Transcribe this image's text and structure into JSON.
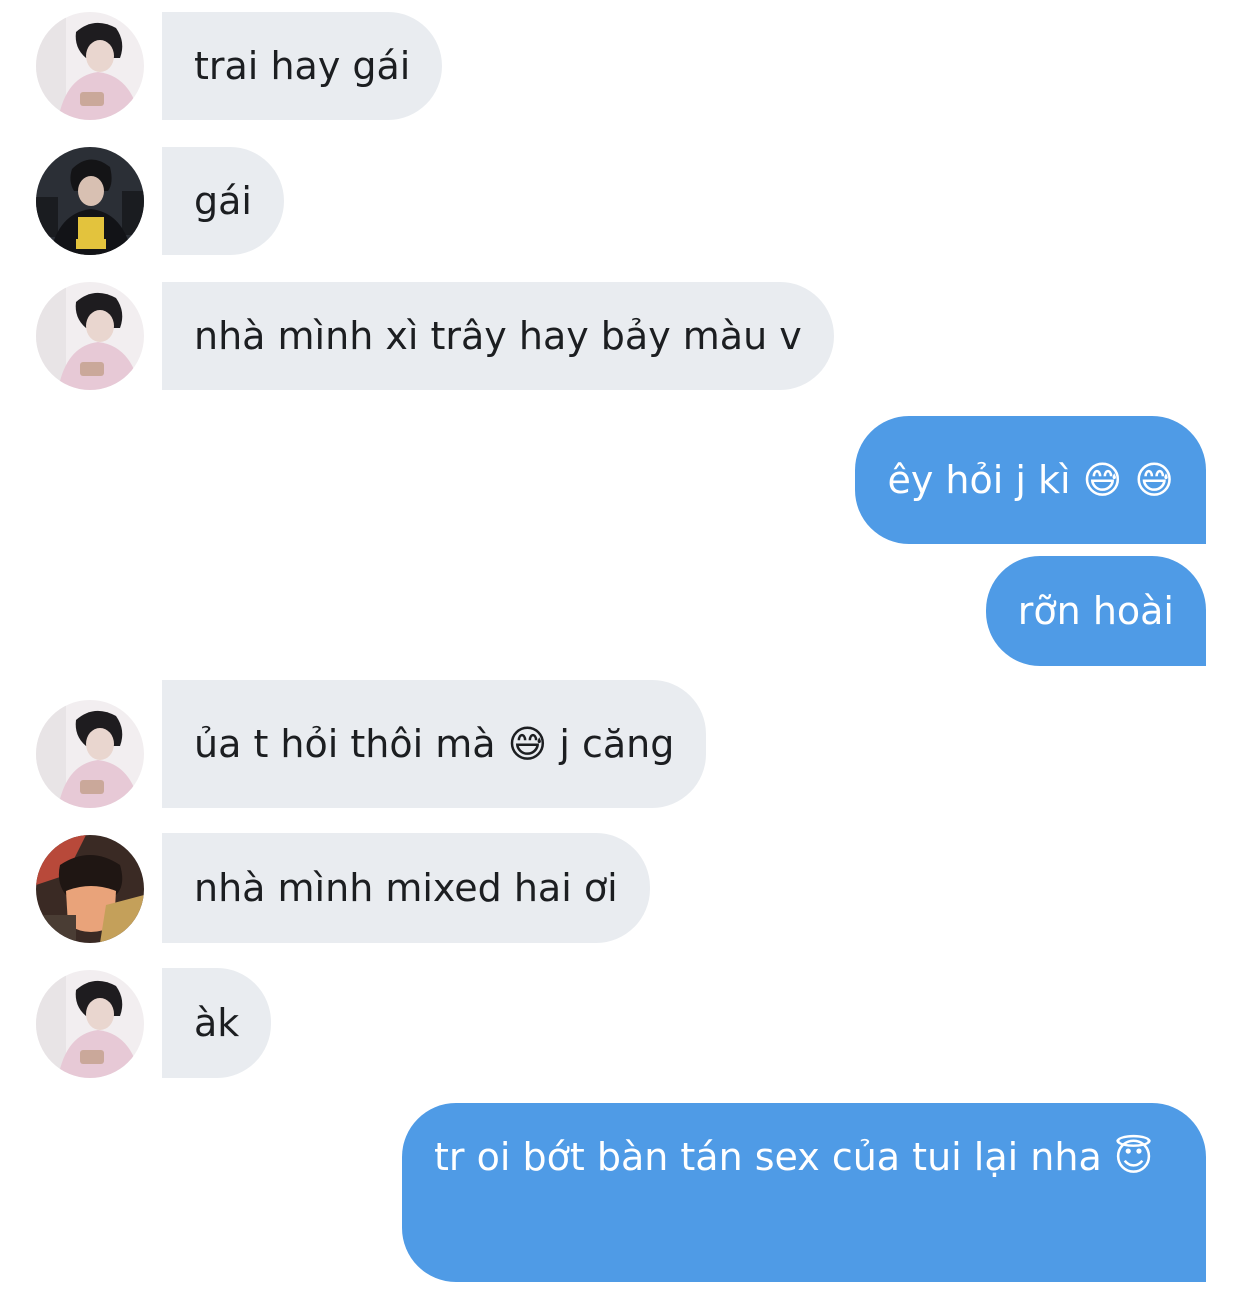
{
  "colors": {
    "incoming_bubble": "#e9ecf0",
    "outgoing_bubble": "#4f9be6",
    "incoming_text": "#1c1e21",
    "outgoing_text": "#ffffff"
  },
  "messages": [
    {
      "direction": "incoming",
      "avatar": "avatar-pink-hoodie",
      "text": "trai hay gái"
    },
    {
      "direction": "incoming",
      "avatar": "avatar-fearx-jersey",
      "text": "gái"
    },
    {
      "direction": "incoming",
      "avatar": "avatar-pink-hoodie",
      "text": "nhà mình xì trây hay bảy màu v"
    },
    {
      "direction": "outgoing",
      "text": "êy hỏi j kì 😅 😅"
    },
    {
      "direction": "outgoing",
      "text": "rỡn hoài"
    },
    {
      "direction": "incoming",
      "avatar": "avatar-pink-hoodie",
      "text": "ủa t hỏi thôi mà 😅 j căng"
    },
    {
      "direction": "incoming",
      "avatar": "avatar-masked-face",
      "text": "nhà mình mixed hai ơi"
    },
    {
      "direction": "incoming",
      "avatar": "avatar-pink-hoodie",
      "text": "àk"
    },
    {
      "direction": "outgoing",
      "text": "tr oi bớt bàn tán sex của tui lại nha 😇"
    }
  ]
}
